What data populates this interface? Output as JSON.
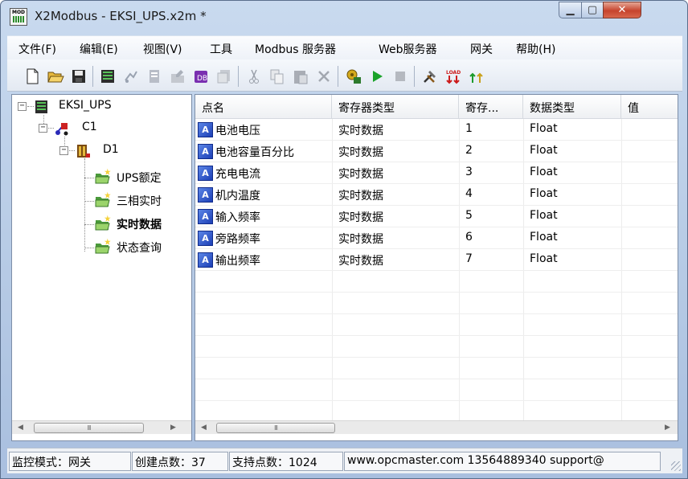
{
  "window": {
    "title": "X2Modbus - EKSI_UPS.x2m *",
    "app_icon_text": "MOD",
    "minimize_glyph": "▁",
    "maximize_glyph": "▢",
    "close_glyph": "✕"
  },
  "menu": [
    {
      "label": "文件(F)"
    },
    {
      "label": "编辑(E)"
    },
    {
      "label": "视图(V)"
    },
    {
      "label": "工具"
    },
    {
      "label": "Modbus 服务器"
    },
    {
      "label": "Web服务器"
    },
    {
      "label": "网关"
    },
    {
      "label": "帮助(H)"
    }
  ],
  "toolbar": {
    "icons": [
      "new-file-icon",
      "open-folder-icon",
      "save-icon",
      "add-channel-icon",
      "add-device-icon",
      "add-group-icon",
      "properties-icon",
      "database-icon",
      "copy-properties-icon",
      "cut-icon",
      "copy-icon",
      "paste-icon",
      "delete-icon",
      "configure-icon",
      "run-icon",
      "stop-icon",
      "tools-icon",
      "load-icon",
      "update-icon"
    ]
  },
  "tree": {
    "root": {
      "label": "EKSI_UPS",
      "expander": "−"
    },
    "channel": {
      "label": "C1",
      "expander": "−"
    },
    "device": {
      "label": "D1",
      "expander": "−"
    },
    "groups": [
      {
        "label": "UPS额定"
      },
      {
        "label": "三相实时"
      },
      {
        "label": "实时数据",
        "selected": true
      },
      {
        "label": "状态查询"
      }
    ]
  },
  "list": {
    "columns": [
      "点名",
      "寄存器类型",
      "寄存...",
      "数据类型",
      "值"
    ],
    "rows": [
      {
        "name": "电池电压",
        "reg_type": "实时数据",
        "reg": "1",
        "data_type": "Float",
        "value": ""
      },
      {
        "name": "电池容量百分比",
        "reg_type": "实时数据",
        "reg": "2",
        "data_type": "Float",
        "value": ""
      },
      {
        "name": "充电电流",
        "reg_type": "实时数据",
        "reg": "3",
        "data_type": "Float",
        "value": ""
      },
      {
        "name": "机内温度",
        "reg_type": "实时数据",
        "reg": "4",
        "data_type": "Float",
        "value": ""
      },
      {
        "name": "输入频率",
        "reg_type": "实时数据",
        "reg": "5",
        "data_type": "Float",
        "value": ""
      },
      {
        "name": "旁路频率",
        "reg_type": "实时数据",
        "reg": "6",
        "data_type": "Float",
        "value": ""
      },
      {
        "name": "输出频率",
        "reg_type": "实时数据",
        "reg": "7",
        "data_type": "Float",
        "value": ""
      }
    ],
    "tag_icon_letter": "A"
  },
  "scroll": {
    "grip": "III",
    "left_arrow": "◀",
    "right_arrow": "▶"
  },
  "status": {
    "mode": "监控模式：网关",
    "created": "创建点数：37",
    "supported": "支持点数：1024",
    "contact": "www.opcmaster.com 13564889340 support@"
  }
}
